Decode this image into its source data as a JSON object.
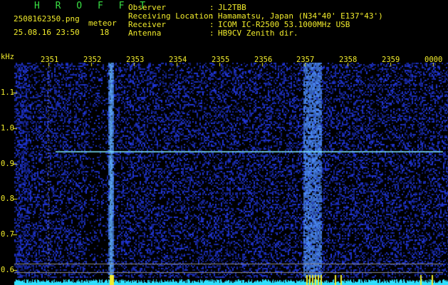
{
  "header": {
    "app_title": "H R O F F T",
    "filename": "2508162350.png",
    "datetime": "25.08.16 23:50",
    "meteor_label": "meteor",
    "meteor_count": "18",
    "info": [
      {
        "label": "Observer",
        "sep": ":",
        "value": "JL2TBB"
      },
      {
        "label": "Receiving Location",
        "sep": ":",
        "value": "Hamamatsu, Japan (N34°40' E137°43')"
      },
      {
        "label": "Receiver",
        "sep": ":",
        "value": "ICOM IC-R2500 53.1000MHz USB"
      },
      {
        "label": "Antenna",
        "sep": ":",
        "value": "HB9CV Zenith dir."
      }
    ]
  },
  "plot": {
    "y_unit": "kHz",
    "time_ticks": [
      "2351",
      "2352",
      "2353",
      "2354",
      "2355",
      "2356",
      "2357",
      "2358",
      "2359",
      "0000"
    ],
    "freq_ticks": [
      "1.1",
      "1.0",
      "0.9",
      "0.8",
      "0.7",
      "0.6"
    ],
    "colors": {
      "background": "#000000",
      "noise": "#1a2a9a",
      "signal": "#7fe8ff",
      "label": "#f2ec2c",
      "title": "#39e043"
    }
  }
}
